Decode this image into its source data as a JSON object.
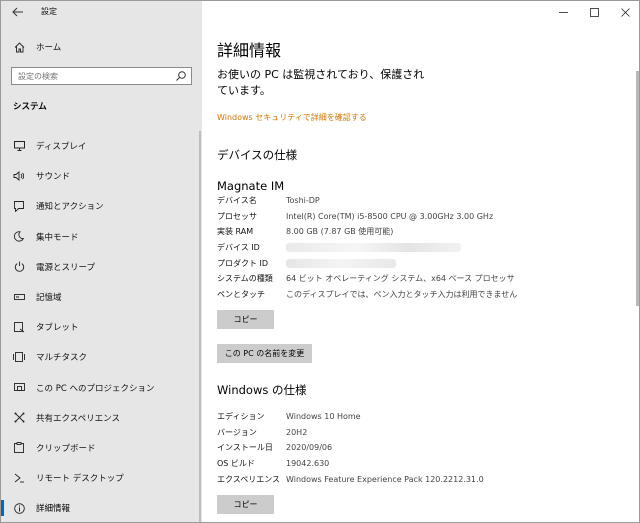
{
  "window": {
    "title": "設定"
  },
  "sidebar": {
    "home_label": "ホーム",
    "search_placeholder": "設定の検索",
    "section_title": "システム",
    "items": [
      {
        "label": "ディスプレイ",
        "icon": "monitor-icon"
      },
      {
        "label": "サウンド",
        "icon": "speaker-icon"
      },
      {
        "label": "通知とアクション",
        "icon": "notification-icon"
      },
      {
        "label": "集中モード",
        "icon": "moon-icon"
      },
      {
        "label": "電源とスリープ",
        "icon": "power-icon"
      },
      {
        "label": "記憶域",
        "icon": "storage-icon"
      },
      {
        "label": "タブレット",
        "icon": "tablet-icon"
      },
      {
        "label": "マルチタスク",
        "icon": "multitask-icon"
      },
      {
        "label": "この PC へのプロジェクション",
        "icon": "projection-icon"
      },
      {
        "label": "共有エクスペリエンス",
        "icon": "share-icon"
      },
      {
        "label": "クリップボード",
        "icon": "clipboard-icon"
      },
      {
        "label": "リモート デスクトップ",
        "icon": "remote-icon"
      },
      {
        "label": "詳細情報",
        "icon": "info-icon"
      }
    ],
    "active_index": 12
  },
  "main": {
    "title": "詳細情報",
    "monitor_text": "お使いの PC は監視されており、保護されています。",
    "security_link": "Windows セキュリティで詳細を確認する",
    "device_spec_heading": "デバイスの仕様",
    "device_name": "Magnate IM",
    "device_specs": [
      {
        "key": "デバイス名",
        "value": "Toshi-DP"
      },
      {
        "key": "プロセッサ",
        "value": "Intel(R) Core(TM) i5-8500 CPU @ 3.00GHz   3.00 GHz"
      },
      {
        "key": "実装 RAM",
        "value": "8.00 GB (7.87 GB 使用可能)"
      },
      {
        "key": "デバイス ID",
        "value": ""
      },
      {
        "key": "プロダクト ID",
        "value": ""
      },
      {
        "key": "システムの種類",
        "value": "64 ビット オペレーティング システム、x64 ベース プロセッサ"
      },
      {
        "key": "ペンとタッチ",
        "value": "このディスプレイでは、ペン入力とタッチ入力は利用できません"
      }
    ],
    "copy_label": "コピー",
    "rename_label": "この PC の名前を変更",
    "windows_spec_heading": "Windows の仕様",
    "windows_specs": [
      {
        "key": "エディション",
        "value": "Windows 10 Home"
      },
      {
        "key": "バージョン",
        "value": "20H2"
      },
      {
        "key": "インストール日",
        "value": "2020/09/06"
      },
      {
        "key": "OS ビルド",
        "value": "19042.630"
      },
      {
        "key": "エクスペリエンス",
        "value": "Windows Feature Experience Pack 120.2212.31.0"
      }
    ],
    "copy2_label": "コピー"
  },
  "colors": {
    "accent": "#0067c0",
    "link": "#d27700",
    "sidebar_bg": "#e6e6e6",
    "button_bg": "#cccccc"
  }
}
